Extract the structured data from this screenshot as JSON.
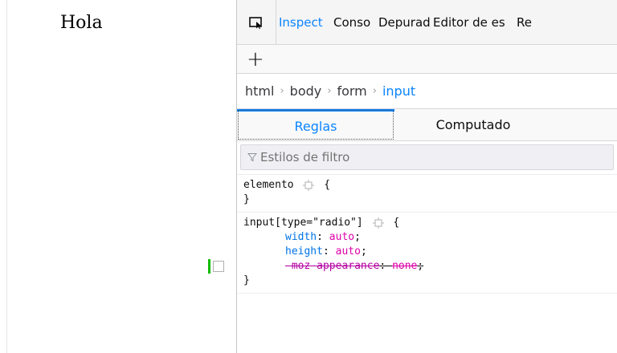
{
  "page": {
    "text": "Hola"
  },
  "devtools": {
    "tabs": [
      {
        "label": "Inspect",
        "selected": true
      },
      {
        "label": "Conso",
        "selected": false
      },
      {
        "label": "Depurad",
        "selected": false
      },
      {
        "label": "Editor de es",
        "selected": false
      },
      {
        "label": "Re",
        "selected": false
      }
    ],
    "add_label": "+",
    "breadcrumbs": [
      "html",
      "body",
      "form",
      "input"
    ],
    "subtabs": {
      "rules": "Reglas",
      "computed": "Computado"
    },
    "filter_placeholder": "Estilos de filtro",
    "rules": {
      "element": {
        "selector": "elemento",
        "open": "{",
        "close": "}"
      },
      "input_radio": {
        "selector": "input[type=\"radio\"]",
        "open": "{",
        "close": "}",
        "declarations": [
          {
            "prop": "width",
            "value": "auto",
            "overridden": false
          },
          {
            "prop": "height",
            "value": "auto",
            "overridden": false
          },
          {
            "prop": "-moz-appearance",
            "value": "none",
            "overridden": true
          }
        ]
      }
    },
    "colors": {
      "accent": "#0a84ff",
      "property": "#0074e8",
      "value": "#dd00a9",
      "enabled_marker": "#12bc00"
    }
  }
}
